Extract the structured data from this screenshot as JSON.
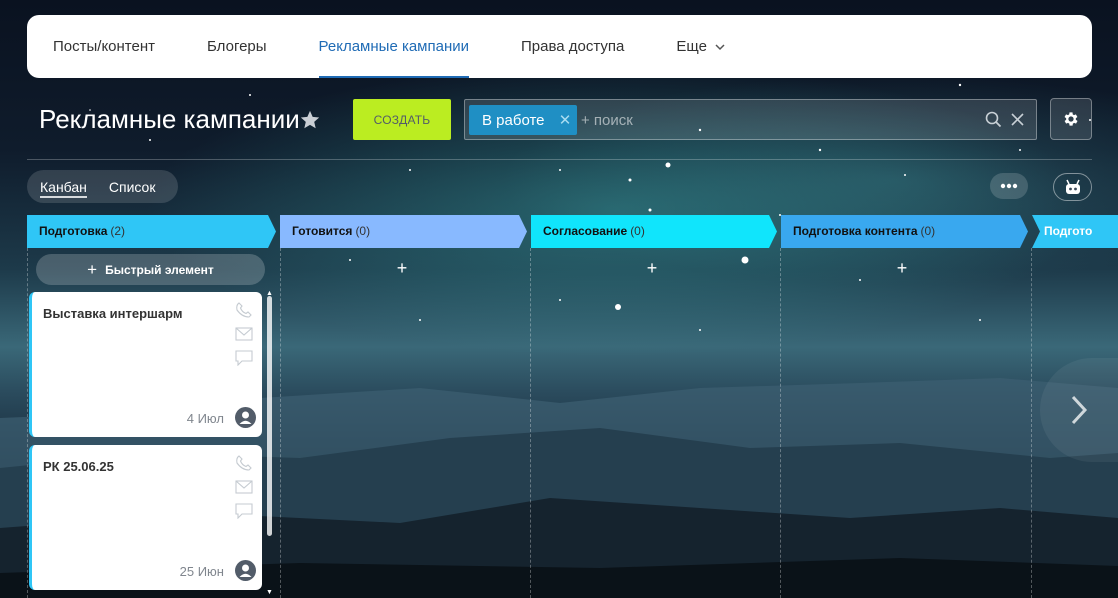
{
  "top_tabs": [
    {
      "label": "Посты/контент"
    },
    {
      "label": "Блогеры"
    },
    {
      "label": "Рекламные кампании",
      "active": true
    },
    {
      "label": "Права доступа"
    },
    {
      "label": "Еще"
    }
  ],
  "page": {
    "title": "Рекламные кампании",
    "create_label": "СОЗДАТЬ"
  },
  "search": {
    "filter_chip": "В работе",
    "placeholder": "+ поиск"
  },
  "view_switch": {
    "kanban": "Канбан",
    "list": "Список",
    "active": "kanban"
  },
  "columns": [
    {
      "name": "Подготовка",
      "count": "(2)",
      "color": "#2fc6f6"
    },
    {
      "name": "Готовится",
      "count": "(0)",
      "color": "#88b9ff"
    },
    {
      "name": "Согласование",
      "count": "(0)",
      "color": "#10e5fc"
    },
    {
      "name": "Подготовка контента",
      "count": "(0)",
      "color": "#39a8ef"
    },
    {
      "name": "Подгото",
      "count": "",
      "color": "#2fc6f6"
    }
  ],
  "quick_add_label": "Быстрый элемент",
  "cards": [
    {
      "title": "Выставка интершарм",
      "date": "4 Июл"
    },
    {
      "title": "РК 25.06.25",
      "date": "25 Июн"
    }
  ],
  "icons": {
    "star": "star-icon",
    "search": "search-icon",
    "clear": "close-icon",
    "settings": "gear-icon",
    "more": "ellipsis-icon",
    "robot": "robot-icon",
    "phone": "phone-icon",
    "mail": "mail-icon",
    "comment": "comment-icon",
    "avatar": "user-icon",
    "next": "chevron-right-icon"
  }
}
